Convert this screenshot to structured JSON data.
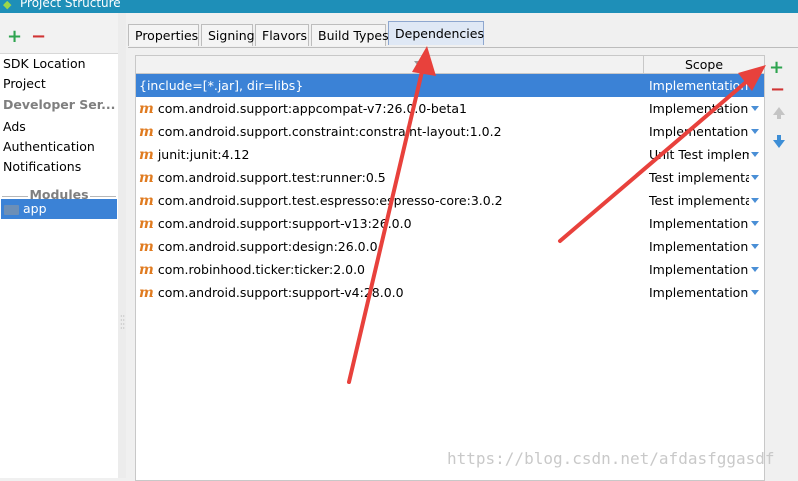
{
  "window": {
    "title": "Project Structure"
  },
  "left_toolbar": {
    "add": "+",
    "remove": "−"
  },
  "nav": {
    "items": [
      "SDK Location",
      "Project"
    ],
    "developer_services": "Developer Ser...",
    "services": [
      "Ads",
      "Authentication",
      "Notifications"
    ],
    "modules_header": "Modules",
    "module": "app"
  },
  "tabs": [
    "Properties",
    "Signing",
    "Flavors",
    "Build Types",
    "Dependencies"
  ],
  "active_tab": "Dependencies",
  "table": {
    "scope_header": "Scope",
    "rows": [
      {
        "name": "{include=[*.jar], dir=libs}",
        "scope": "Implementation",
        "maven": "",
        "selected": true
      },
      {
        "name": "com.android.support:appcompat-v7:26.0.0-beta1",
        "scope": "Implementation",
        "maven": "m"
      },
      {
        "name": "com.android.support.constraint:constraint-layout:1.0.2",
        "scope": "Implementation",
        "maven": "m"
      },
      {
        "name": "junit:junit:4.12",
        "scope": "Unit Test implem...",
        "maven": "m"
      },
      {
        "name": "com.android.support.test:runner:0.5",
        "scope": "Test implementat...",
        "maven": "m"
      },
      {
        "name": "com.android.support.test.espresso:espresso-core:3.0.2",
        "scope": "Test implementat...",
        "maven": "m"
      },
      {
        "name": "com.android.support:support-v13:26.0.0",
        "scope": "Implementation",
        "maven": "m"
      },
      {
        "name": "com.android.support:design:26.0.0",
        "scope": "Implementation",
        "maven": "m"
      },
      {
        "name": "com.robinhood.ticker:ticker:2.0.0",
        "scope": "Implementation",
        "maven": "m"
      },
      {
        "name": "com.android.support:support-v4:28.0.0",
        "scope": "Implementation",
        "maven": "m"
      }
    ]
  },
  "right_toolbar": {
    "add": "+",
    "remove": "−"
  },
  "watermark": "https://blog.csdn.net/afdasfggasdf",
  "colors": {
    "selection": "#3b82d6",
    "annotation_arrow": "#e8413c",
    "title_bar": "#1e8fb8"
  }
}
